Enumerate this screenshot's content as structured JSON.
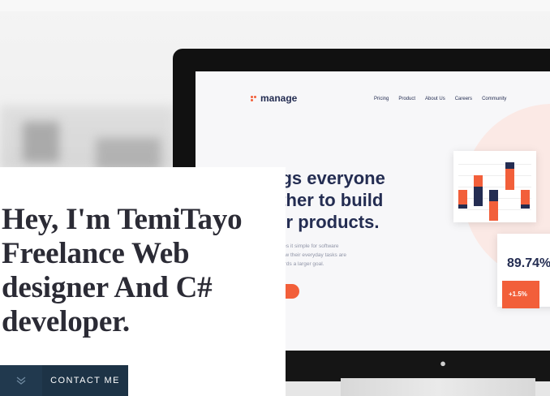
{
  "hero": {
    "headline_lines": [
      "Hey, I'm TemiTayo",
      "Freelance Web",
      "designer And C#",
      "developer."
    ],
    "cta_label": "CONTACT ME",
    "cta_icon": "chevron-double-down-icon"
  },
  "mockup": {
    "logo_text": "manage",
    "nav": [
      "Pricing",
      "Product",
      "About Us",
      "Careers",
      "Community"
    ],
    "hero_lines": [
      "ngs everyone",
      "ether to build",
      "ter products."
    ],
    "body_lines": [
      "makes it simple for software",
      "te how their everyday tasks are",
      "towards a larger goal."
    ],
    "stat_value": "89.74%",
    "stat_change": "+1.5%",
    "apple_icon": "apple-logo-icon"
  },
  "colors": {
    "accent": "#f25f3a",
    "navy": "#242d52",
    "cta_bg": "#1d3346",
    "headline": "#2b2b35"
  }
}
